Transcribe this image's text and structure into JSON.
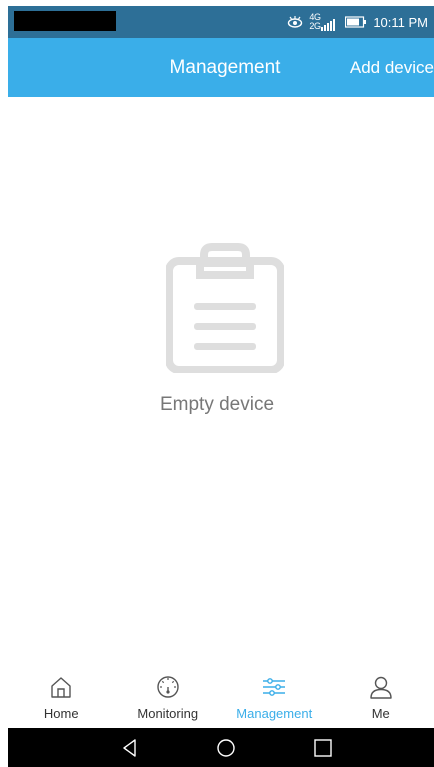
{
  "status_bar": {
    "time": "10:11 PM",
    "network_label": "4G 2G"
  },
  "header": {
    "title": "Management",
    "action_label": "Add device"
  },
  "empty_state": {
    "icon": "clipboard-icon",
    "message": "Empty device"
  },
  "bottom_nav": {
    "items": [
      {
        "label": "Home",
        "icon": "home-icon",
        "active": false
      },
      {
        "label": "Monitoring",
        "icon": "gauge-icon",
        "active": false
      },
      {
        "label": "Management",
        "icon": "sliders-icon",
        "active": true
      },
      {
        "label": "Me",
        "icon": "user-icon",
        "active": false
      }
    ]
  },
  "system_nav": {
    "back_icon": "back-triangle-icon",
    "home_icon": "home-circle-icon",
    "recents_icon": "recents-square-icon"
  },
  "colors": {
    "status_bar": "#2d6f97",
    "header": "#3aaee9",
    "active": "#3aaee9",
    "empty_icon": "#dedede",
    "empty_text": "#777777"
  }
}
